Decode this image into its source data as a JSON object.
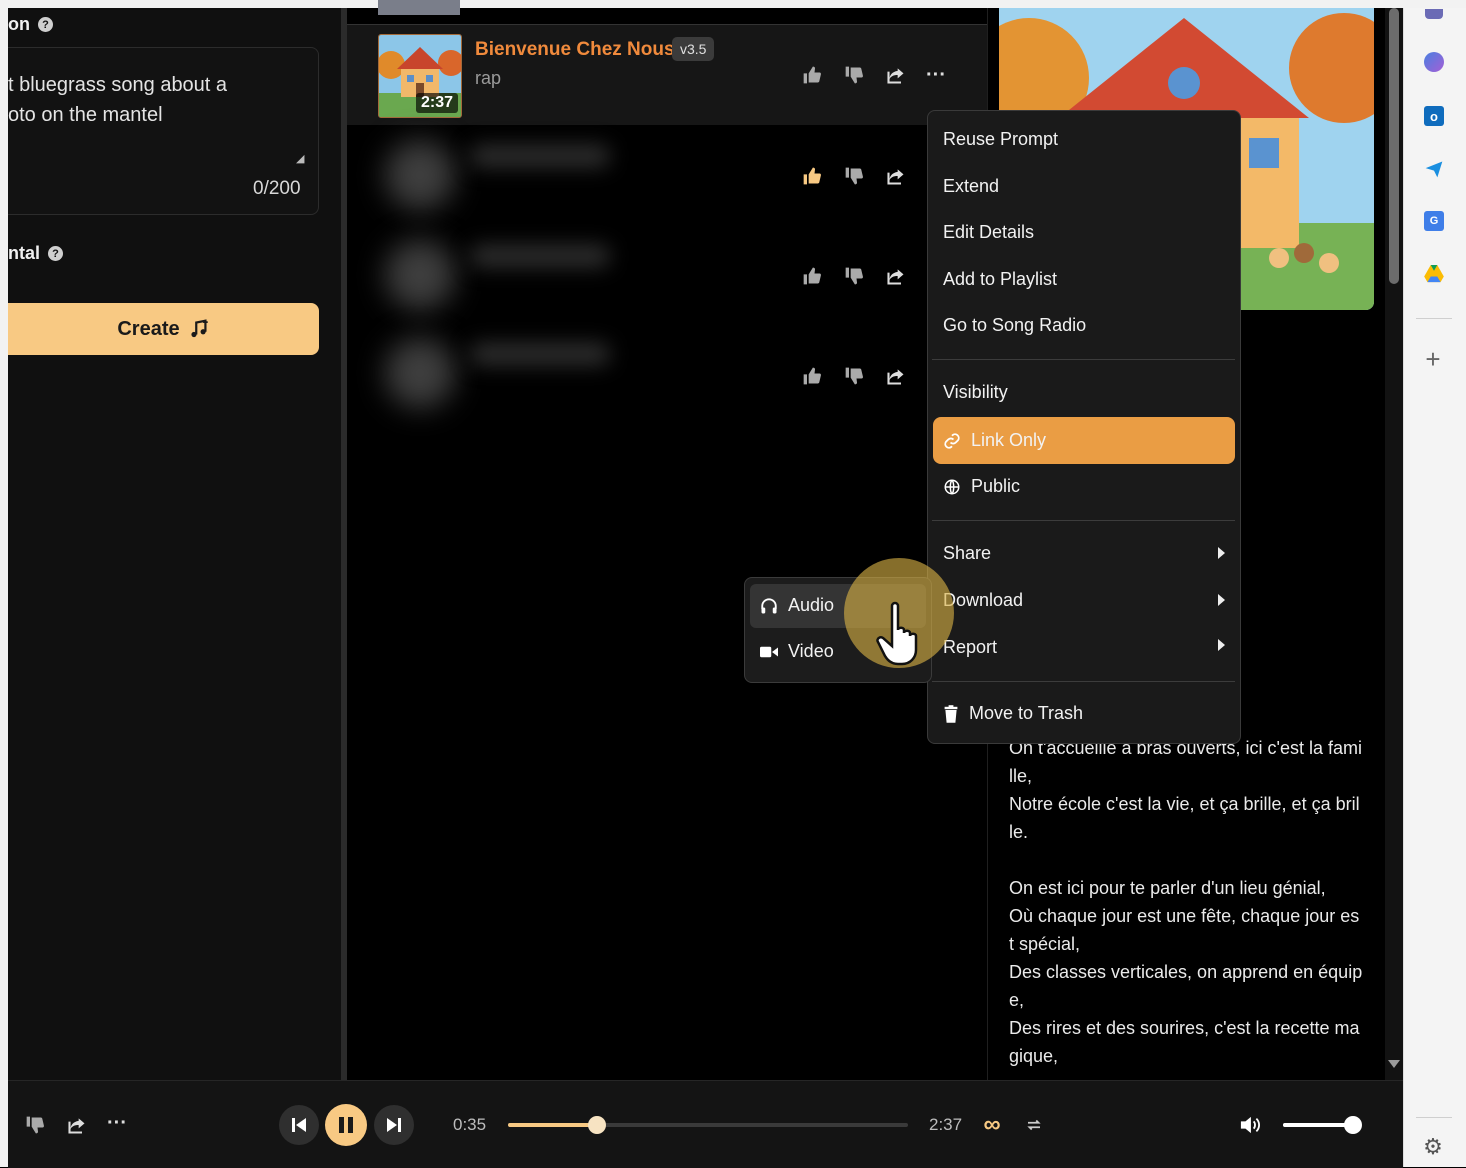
{
  "create_panel": {
    "description_label": "on",
    "prompt_text": "t bluegrass song about a\noto on the mantel",
    "char_counter": "0/200",
    "instrumental_label": "ntal",
    "create_button": "Create"
  },
  "songs": {
    "active": {
      "title": "Bienvenue Chez Nous",
      "version": "v3.5",
      "genre": "rap",
      "duration": "2:37"
    }
  },
  "context_menu": {
    "items": [
      "Reuse Prompt",
      "Extend",
      "Edit Details",
      "Add to Playlist",
      "Go to Song Radio"
    ],
    "visibility_label": "Visibility",
    "visibility_options": [
      "Link Only",
      "Public"
    ],
    "selected_visibility": "Link Only",
    "submenus": [
      "Share",
      "Download",
      "Report"
    ],
    "trash": "Move to Trash"
  },
  "download_submenu": {
    "items": [
      "Audio",
      "Video"
    ]
  },
  "lyrics": {
    "text": "là où tout est p\nnotre mission,\nc'est notre cible,\nOn t'accueille à bras ouverts, ici c'est la fami\nlle,\nNotre école c'est la vie, et ça brille, et ça bril\nle.\n\nOn est ici pour te parler d'un lieu génial,\nOù chaque jour est une fête, chaque jour es\nt spécial,\nDes classes verticales, on apprend en équip\ne,\nDes rires et des sourires, c'est la recette ma\ngique,"
  },
  "player": {
    "current_time": "0:35",
    "total_time": "2:37",
    "progress": 0.223,
    "volume": 1.0
  },
  "colors": {
    "accent": "#f8c983",
    "menu_highlight": "#ea9d44",
    "title_orange": "#f08a3c"
  }
}
